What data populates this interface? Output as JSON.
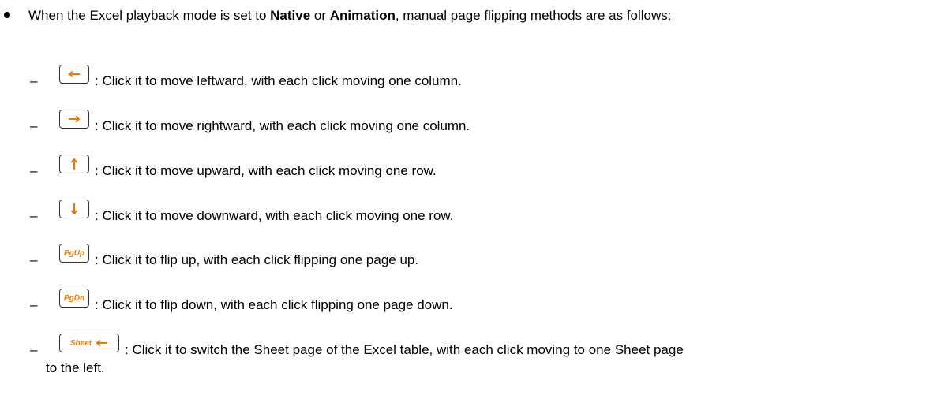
{
  "intro": {
    "part1": "When the Excel playback mode is set to ",
    "mode1": "Native",
    "or": " or ",
    "mode2": "Animation",
    "part2": ", manual page flipping methods are as follows:"
  },
  "items": [
    {
      "key_icon": "arrow-left-icon",
      "text": ": Click it to move leftward, with each click moving one column."
    },
    {
      "key_icon": "arrow-right-icon",
      "text": ": Click it to move rightward, with each click moving one column."
    },
    {
      "key_icon": "arrow-up-icon",
      "text": ": Click it to move upward, with each click moving one row."
    },
    {
      "key_icon": "arrow-down-icon",
      "text": ": Click it to move downward, with each click moving one row."
    },
    {
      "key_label": "PgUp",
      "text": ": Click it to flip up, with each click flipping one page up."
    },
    {
      "key_label": "PgDn",
      "text": ": Click it to flip down, with each click flipping one page down."
    },
    {
      "key_label": "Sheet",
      "key_icon": "arrow-left-icon",
      "text": ": Click it to switch the Sheet page of the Excel table, with each click moving to one Sheet page",
      "text_cont": "to the left."
    }
  ],
  "dash": "–",
  "colors": {
    "key_accent": "#f07800",
    "key_border": "#303030"
  }
}
